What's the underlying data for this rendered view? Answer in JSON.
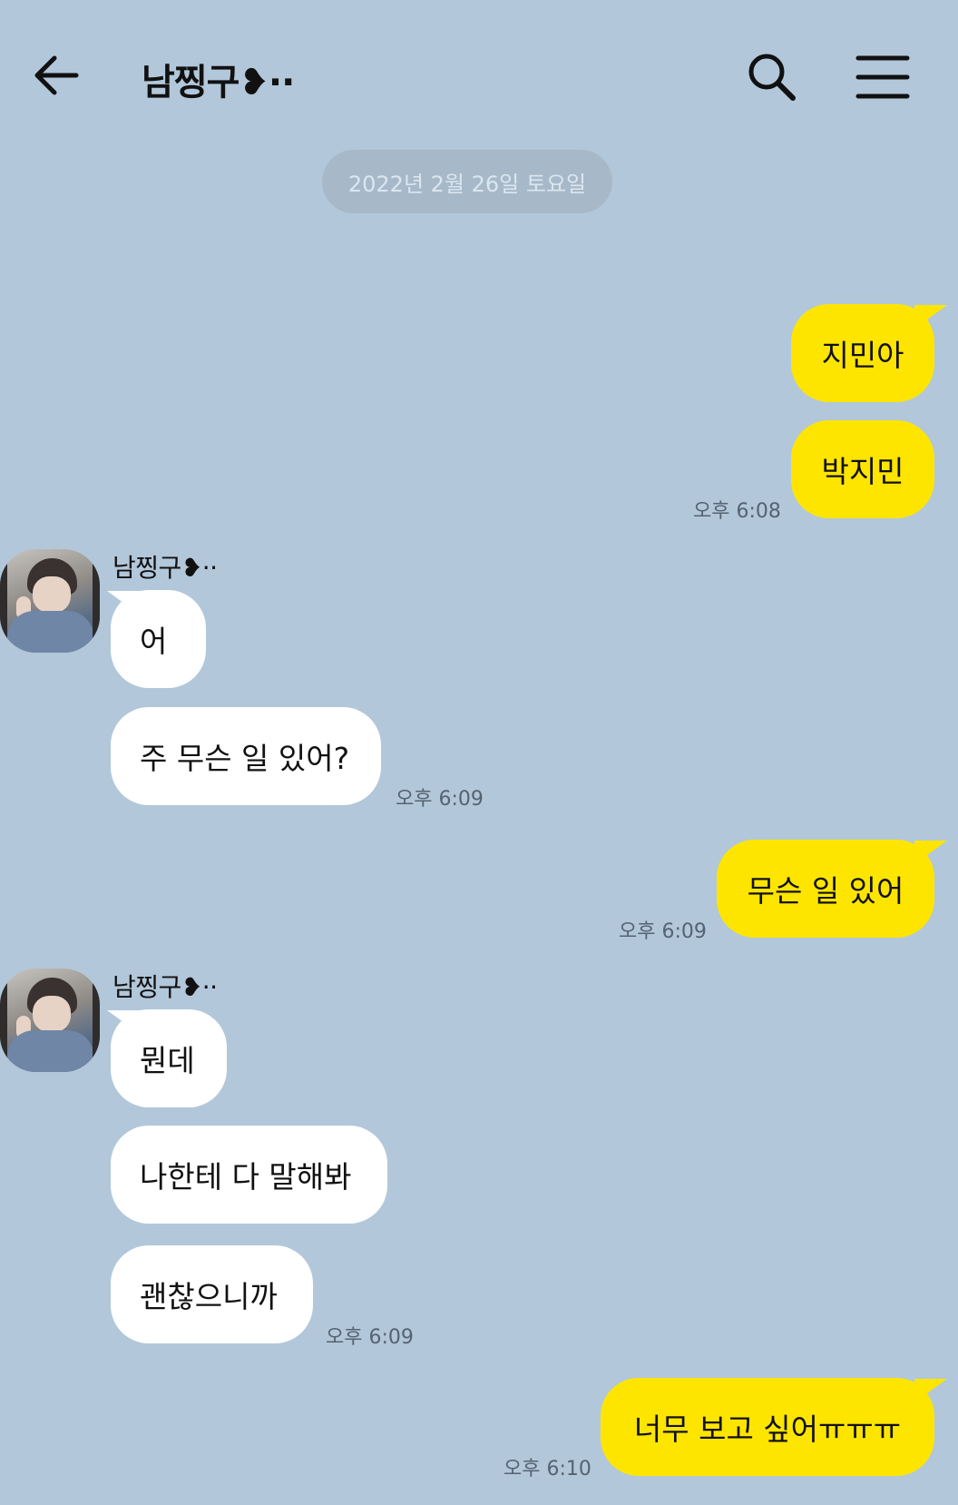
{
  "header": {
    "title": "남찡구❥··",
    "icons": {
      "back": "arrow-left-icon",
      "search": "search-icon",
      "menu": "hamburger-menu-icon"
    }
  },
  "date_divider": "2022년 2월 26일 토요일",
  "colors": {
    "background": "#b2c7da",
    "my_bubble": "#fee500",
    "their_bubble": "#ffffff"
  },
  "messages": [
    {
      "from": "me",
      "text": "지민아"
    },
    {
      "from": "me",
      "text": "박지민",
      "time": "오후 6:08"
    },
    {
      "from": "them",
      "sender": "남찡구❥··",
      "text": "어"
    },
    {
      "from": "them",
      "text": "주 무슨 일 있어?",
      "time": "오후 6:09"
    },
    {
      "from": "me",
      "text": "무슨 일 있어",
      "time": "오후 6:09"
    },
    {
      "from": "them",
      "sender": "남찡구❥··",
      "text": "뭔데"
    },
    {
      "from": "them",
      "text": "나한테 다 말해봐"
    },
    {
      "from": "them",
      "text": "괜찮으니까",
      "time": "오후 6:09"
    },
    {
      "from": "me",
      "text": "너무 보고 싶어ㅠㅠㅠ",
      "time": "오후 6:10"
    }
  ]
}
